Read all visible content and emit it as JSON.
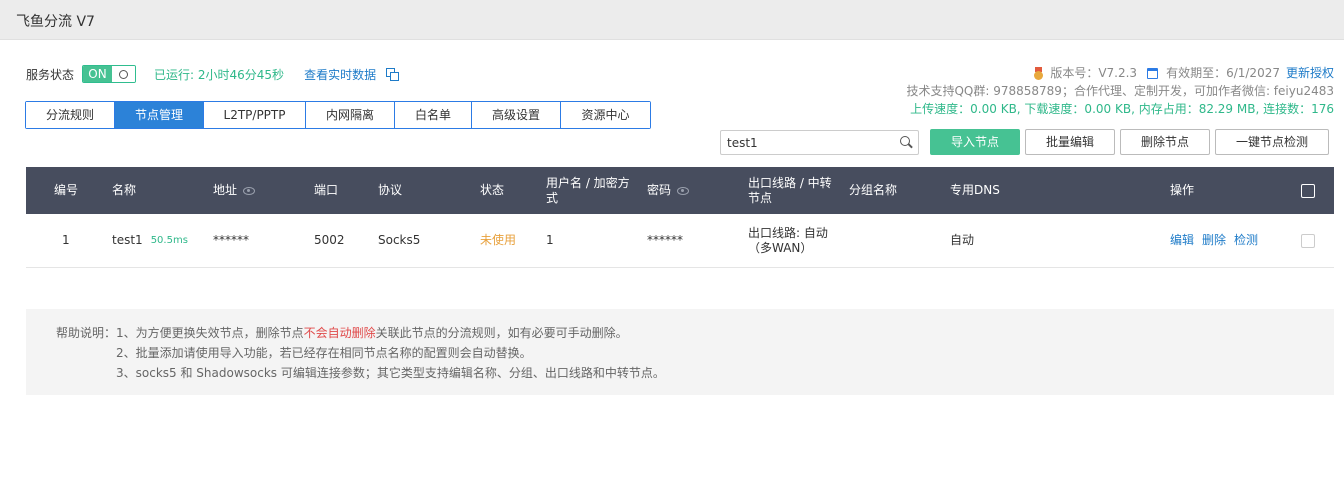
{
  "window": {
    "title": "飞鱼分流 V7"
  },
  "status": {
    "label": "服务状态",
    "toggle_on": "ON",
    "uptime": "已运行: 2小时46分45秒",
    "realtime_link": "查看实时数据"
  },
  "info": {
    "version": "版本号：V7.2.3",
    "expiry": "有效期至：6/1/2027",
    "update_link": "更新授权",
    "support": "技术支持QQ群: 978858789；合作代理、定制开发，可加作者微信: feiyu2483",
    "stats": "上传速度：0.00 KB, 下载速度：0.00 KB, 内存占用：82.29 MB, 连接数：176"
  },
  "tabs": [
    {
      "label": "分流规则"
    },
    {
      "label": "节点管理"
    },
    {
      "label": "L2TP/PPTP"
    },
    {
      "label": "内网隔离"
    },
    {
      "label": "白名单"
    },
    {
      "label": "高级设置"
    },
    {
      "label": "资源中心"
    }
  ],
  "search": {
    "value": "test1"
  },
  "toolbar": {
    "import": "导入节点",
    "batch_edit": "批量编辑",
    "delete": "删除节点",
    "check_all": "一键节点检测"
  },
  "table": {
    "headers": {
      "id": "编号",
      "name": "名称",
      "address": "地址",
      "port": "端口",
      "protocol": "协议",
      "status": "状态",
      "user": "用户名 / 加密方式",
      "password": "密码",
      "route": "出口线路 / 中转节点",
      "group": "分组名称",
      "dns": "专用DNS",
      "ops": "操作"
    },
    "rows": [
      {
        "id": "1",
        "name": "test1",
        "latency": "50.5ms",
        "address": "******",
        "port": "5002",
        "protocol": "Socks5",
        "status": "未使用",
        "user": "1",
        "password": "******",
        "route_line1": "出口线路: 自动",
        "route_line2": "（多WAN）",
        "group": "",
        "dns": "自动",
        "op_edit": "编辑",
        "op_delete": "删除",
        "op_check": "检测"
      }
    ]
  },
  "help": {
    "line1_prefix": "帮助说明：1、为方便更换失效节点，删除节点",
    "line1_warn": "不会自动删除",
    "line1_suffix": "关联此节点的分流规则，如有必要可手动删除。",
    "line2": "2、批量添加请使用导入功能，若已经存在相同节点名称的配置则会自动替换。",
    "line3": "3、socks5 和 Shadowsocks 可编辑连接参数；其它类型支持编辑名称、分组、出口线路和中转节点。"
  },
  "colors": {
    "accent_green": "#46c293",
    "accent_blue": "#2c82d8",
    "link_blue": "#1e7bc8",
    "header_dark": "#474d5e",
    "warning_red": "#e04a4a",
    "unused_orange": "#e8a13d"
  }
}
